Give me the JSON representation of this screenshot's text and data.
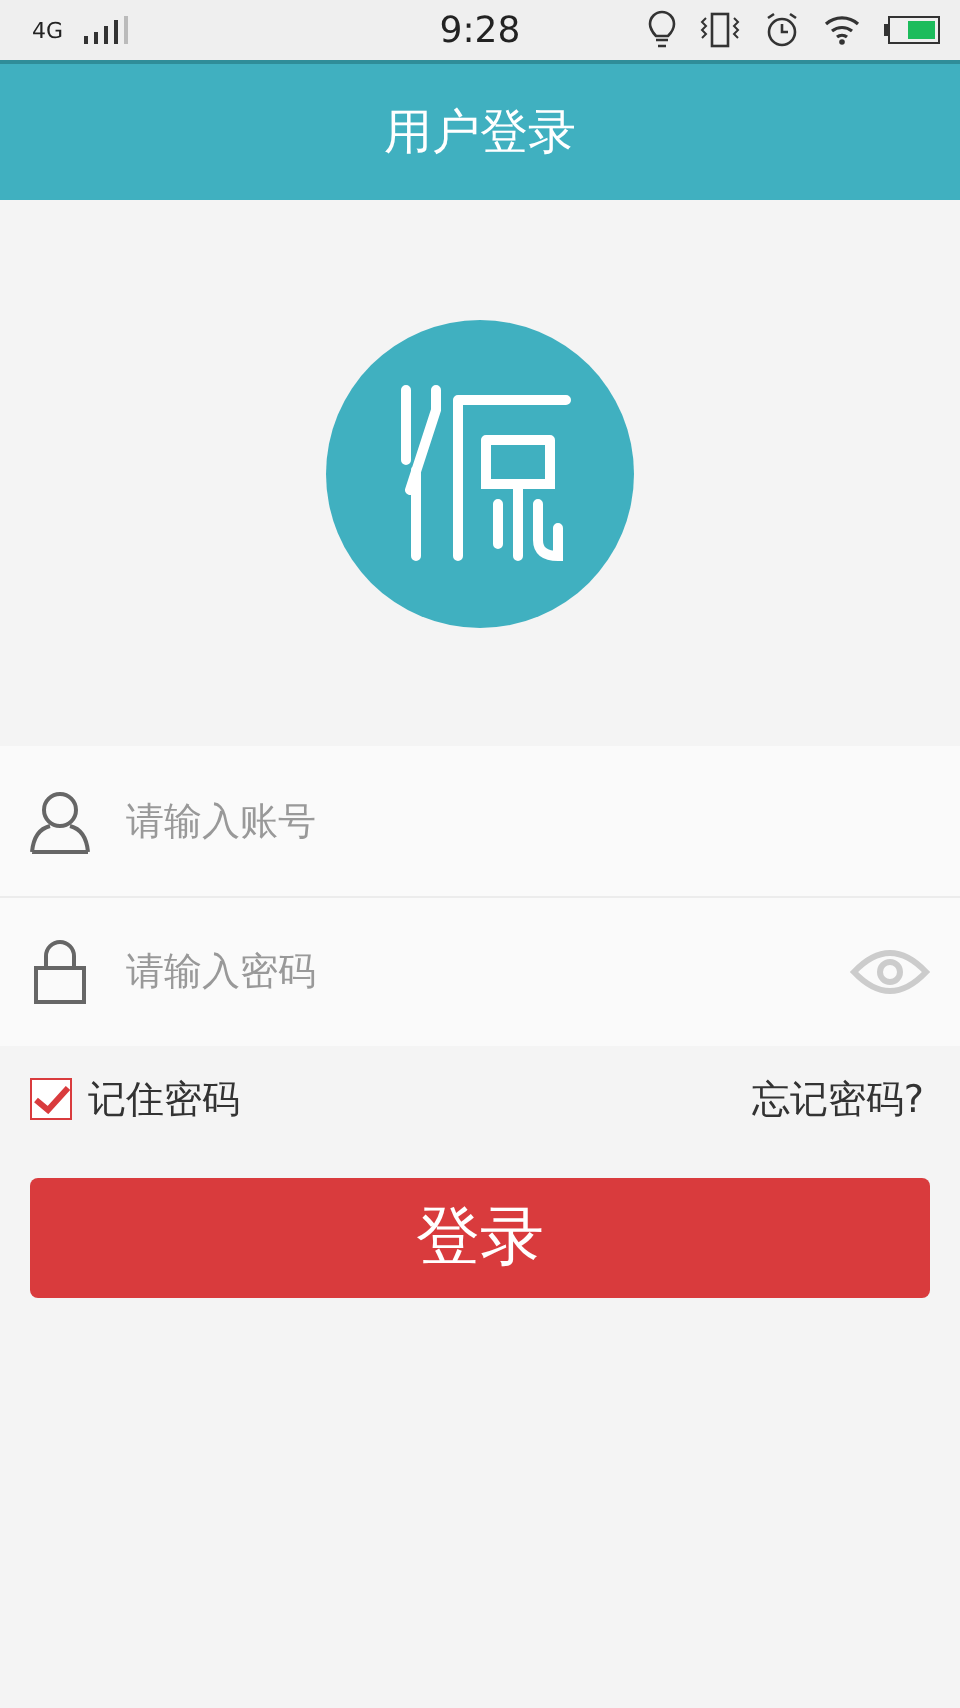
{
  "status_bar": {
    "network": "4G",
    "time": "9:28"
  },
  "header": {
    "title": "用户登录"
  },
  "form": {
    "account": {
      "placeholder": "请输入账号"
    },
    "password": {
      "placeholder": "请输入密码"
    },
    "remember": {
      "label": "记住密码",
      "checked": true
    },
    "forgot": "忘记密码?",
    "submit": "登录"
  }
}
